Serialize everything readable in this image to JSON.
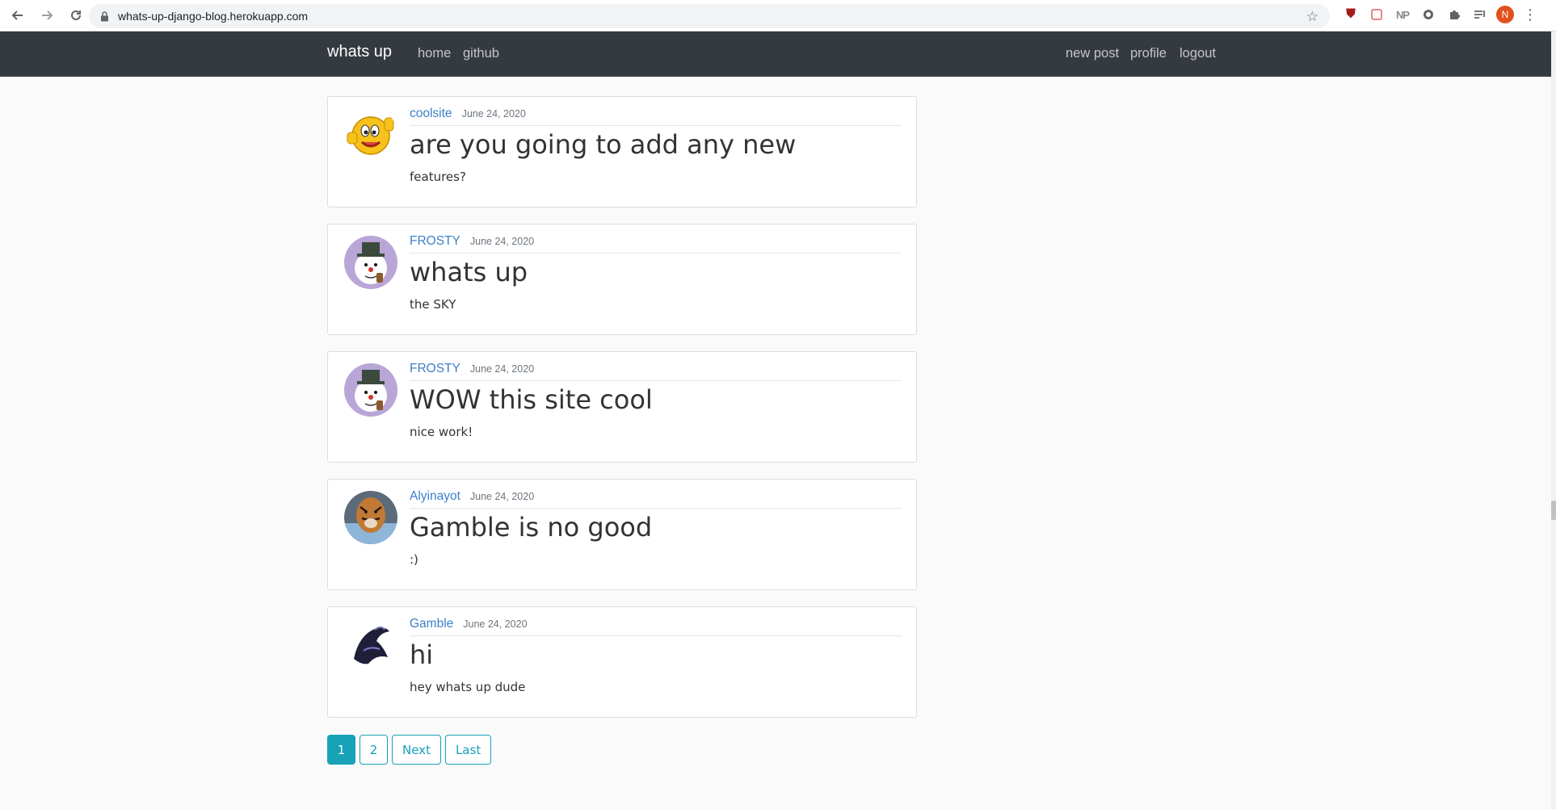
{
  "browser": {
    "url": "whats-up-django-blog.herokuapp.com",
    "profile_initial": "N",
    "ext_np": "NP"
  },
  "navbar": {
    "brand": "whats up",
    "links_left": [
      "home",
      "github"
    ],
    "links_right": [
      "new post",
      "profile",
      "logout"
    ]
  },
  "posts": [
    {
      "author": "coolsite",
      "date": "June 24, 2020",
      "title": "are you going to add any new",
      "body": "features?",
      "avatar": "thumbs-up-emoji"
    },
    {
      "author": "FROSTY",
      "date": "June 24, 2020",
      "title": "whats up",
      "body": "the SKY",
      "avatar": "snowman"
    },
    {
      "author": "FROSTY",
      "date": "June 24, 2020",
      "title": "WOW this site cool",
      "body": "nice work!",
      "avatar": "snowman"
    },
    {
      "author": "Alyinayot",
      "date": "June 24, 2020",
      "title": "Gamble is no good",
      "body": ":)",
      "avatar": "tiger"
    },
    {
      "author": "Gamble",
      "date": "June 24, 2020",
      "title": "hi",
      "body": "hey whats up dude",
      "avatar": "dark-figure"
    }
  ],
  "pagination": [
    "1",
    "2",
    "Next",
    "Last"
  ],
  "colors": {
    "navbar": "#343a40",
    "link": "#3d7fc9",
    "pager_accent": "#17a2b8",
    "profile": "#e2501e"
  }
}
